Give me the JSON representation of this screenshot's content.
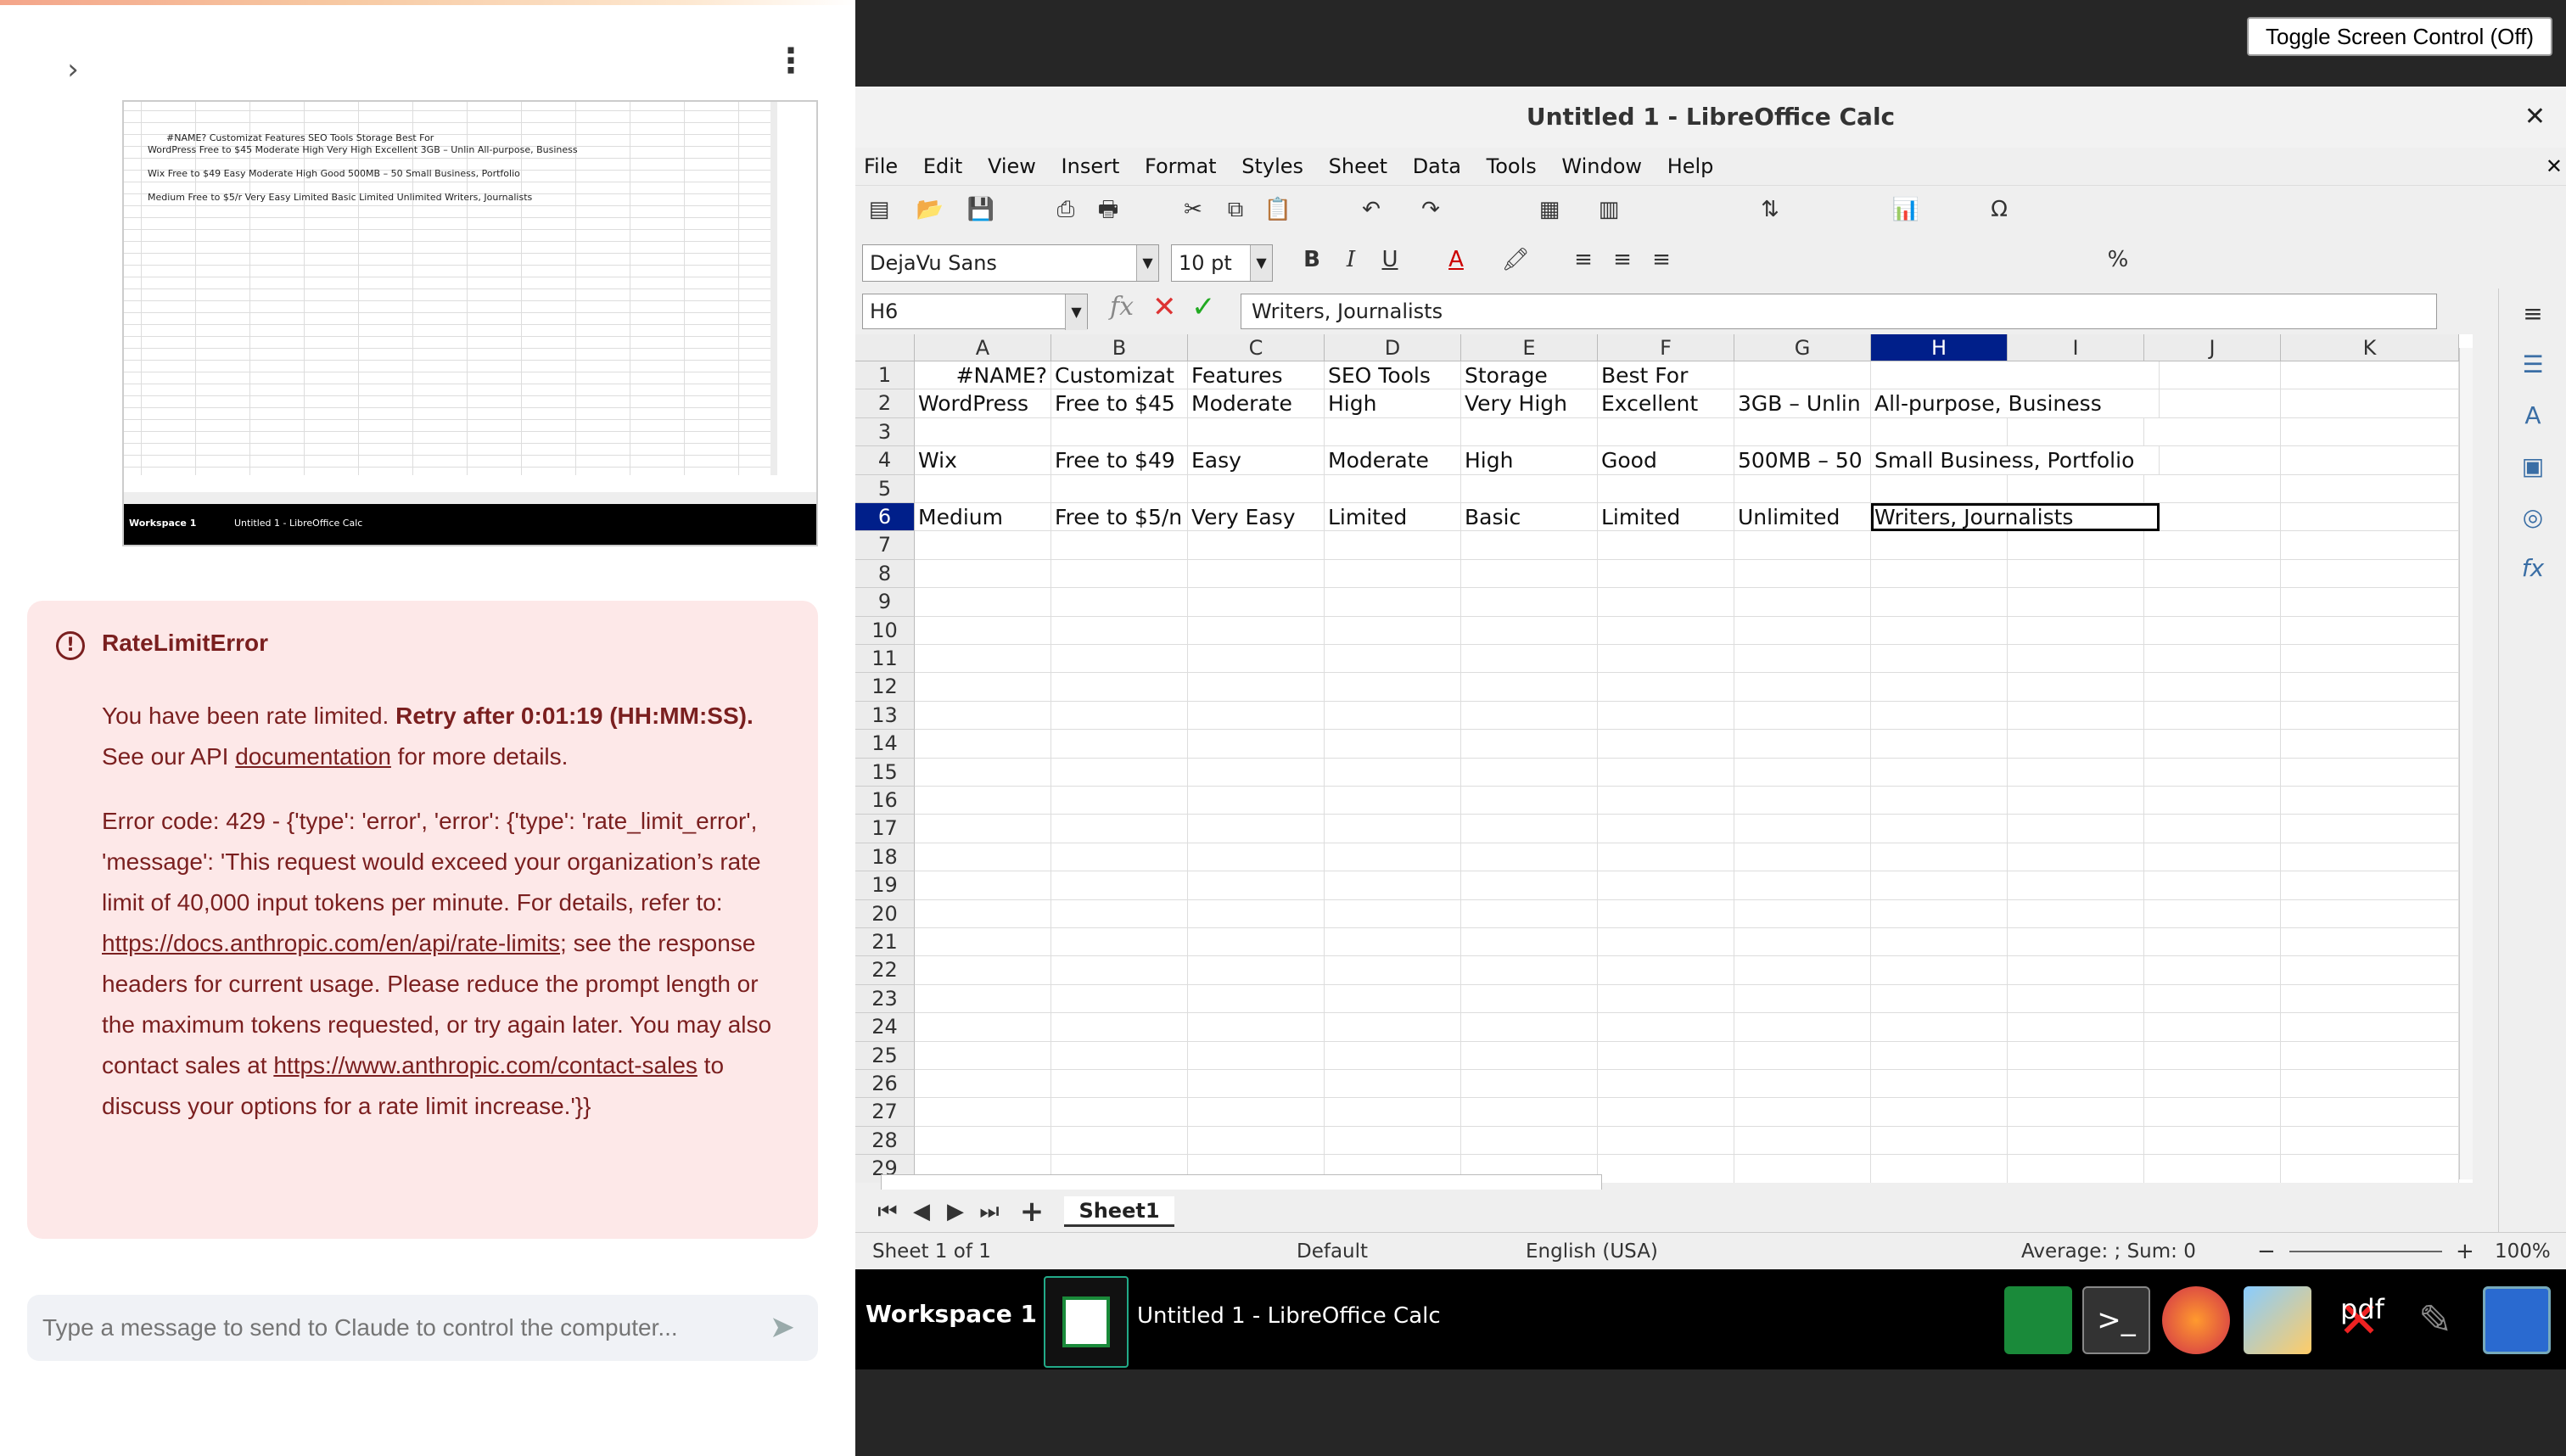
{
  "left_panel": {
    "error": {
      "title": "RateLimitError",
      "p1_a": "You have been rate limited. ",
      "p1_b": "Retry after 0:01:19 (HH:MM:SS).",
      "p1_c": " See our API ",
      "p1_link": "documentation",
      "p1_d": " for more details.",
      "p2_a": "Error code: 429 - {'type': 'error', 'error': {'type': 'rate_limit_error', 'message': 'This request would exceed your organization’s rate limit of 40,000 input tokens per minute. For details, refer to: ",
      "p2_link1": "https://docs.anthropic.com/en/api/rate-limits",
      "p2_b": "; see the response headers for current usage. Please reduce the prompt length or the maximum tokens requested, or try again later. You may also contact sales at ",
      "p2_link2": "https://www.anthropic.com/contact-sales",
      "p2_c": " to discuss your options for a rate limit increase.'}}"
    },
    "chat_placeholder": "Type a message to send to Claude to control the computer..."
  },
  "toggle_label": "Toggle Screen Control (Off)",
  "window": {
    "title": "Untitled 1 - LibreOffice Calc",
    "menu": [
      "File",
      "Edit",
      "View",
      "Insert",
      "Format",
      "Styles",
      "Sheet",
      "Data",
      "Tools",
      "Window",
      "Help"
    ],
    "font_name": "DejaVu Sans",
    "font_size": "10 pt",
    "name_box": "H6",
    "formula": "Writers, Journalists"
  },
  "sheet": {
    "columns": [
      "A",
      "B",
      "C",
      "D",
      "E",
      "F",
      "G",
      "H",
      "I",
      "J",
      "K"
    ],
    "rows": [
      "1",
      "2",
      "3",
      "4",
      "5",
      "6",
      "7",
      "8",
      "9",
      "10",
      "11",
      "12",
      "13",
      "14",
      "15",
      "16",
      "17",
      "18",
      "19",
      "20",
      "21",
      "22",
      "23",
      "24",
      "25",
      "26",
      "27",
      "28",
      "29"
    ],
    "data": {
      "r1": [
        "#NAME?",
        "Customizat",
        "Features",
        "SEO Tools",
        "Storage",
        "Best For",
        "",
        "",
        "",
        "",
        ""
      ],
      "r2": [
        "WordPress",
        "Free to $45",
        "Moderate",
        "High",
        "Very High",
        "Excellent",
        "3GB – Unlin",
        "All-purpose, Business",
        "",
        "",
        ""
      ],
      "r4": [
        "Wix",
        "Free to $49",
        "Easy",
        "Moderate",
        "High",
        "Good",
        "500MB – 50",
        "Small Business, Portfolio",
        "",
        "",
        ""
      ],
      "r6": [
        "Medium",
        "Free to $5/n",
        "Very Easy",
        "Limited",
        "Basic",
        "Limited",
        "Unlimited",
        "Writers, Journalists",
        "",
        "",
        ""
      ]
    },
    "tab": "Sheet1"
  },
  "status": {
    "sheet": "Sheet 1 of 1",
    "style": "Default",
    "lang": "English (USA)",
    "sum": "Average: ; Sum: 0",
    "zoom": "100%"
  },
  "taskbar": {
    "workspace": "Workspace 1",
    "app_title": "Untitled 1 - LibreOffice Calc",
    "pdf": "pdf"
  },
  "thumb": {
    "r1": "#NAME?  Customizat Features  SEO Tools  Storage   Best For",
    "r2": "WordPress  Free to $45 Moderate  High     Very High  Excellent  3GB – Unlin All-purpose, Business",
    "r4": "Wix        Free to $49 Easy      Moderate  High     Good       500MB – 50 Small Business, Portfolio",
    "r6": "Medium     Free to $5/r Very Easy Limited  Basic    Limited    Unlimited  Writers, Journalists"
  }
}
